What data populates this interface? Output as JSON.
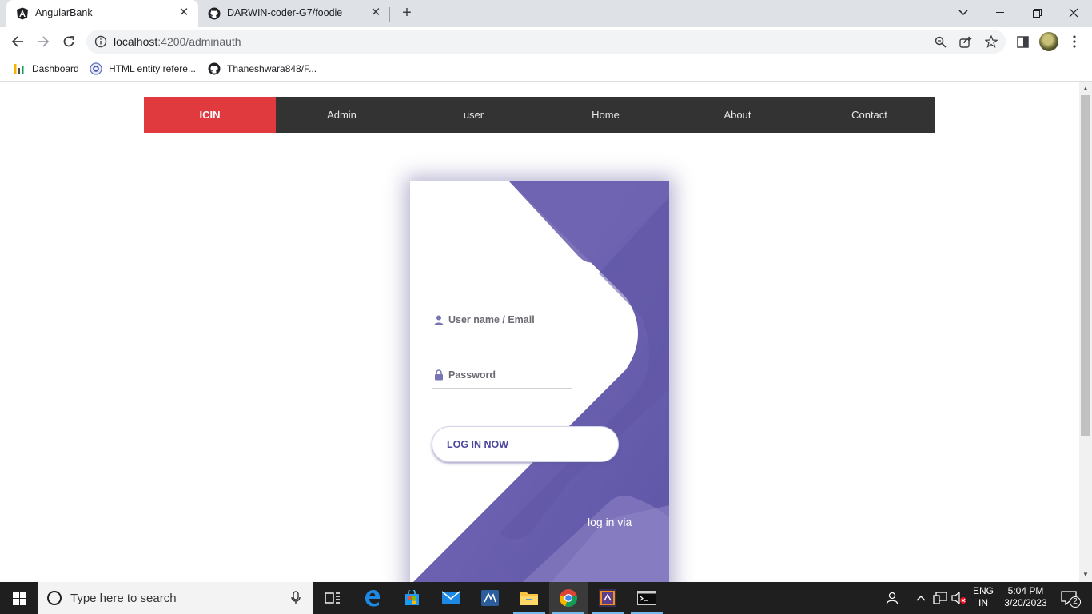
{
  "browser": {
    "tabs": [
      {
        "title": "AngularBank",
        "active": true
      },
      {
        "title": "DARWIN-coder-G7/foodie",
        "active": false
      }
    ],
    "url_host": "localhost",
    "url_path": ":4200/adminauth",
    "bookmarks": [
      {
        "label": "Dashboard",
        "icon": "dashboard-icon"
      },
      {
        "label": "HTML entity refere...",
        "icon": "html-entity-icon"
      },
      {
        "label": "Thaneshwara848/F...",
        "icon": "github-icon"
      }
    ]
  },
  "page": {
    "nav": {
      "brand": "ICIN",
      "items": [
        "Admin",
        "user",
        "Home",
        "About",
        "Contact"
      ],
      "brand_color": "#e0393e",
      "bar_color": "#333333"
    },
    "login": {
      "username_placeholder": "User name / Email",
      "password_placeholder": "Password",
      "button_label": "LOG IN NOW",
      "via_text": "log in via",
      "accent_color": "#4c489d"
    }
  },
  "taskbar": {
    "search_placeholder": "Type here to search",
    "language_top": "ENG",
    "language_bottom": "IN",
    "time": "5:04 PM",
    "date": "3/20/2023",
    "notification_count": "2"
  }
}
